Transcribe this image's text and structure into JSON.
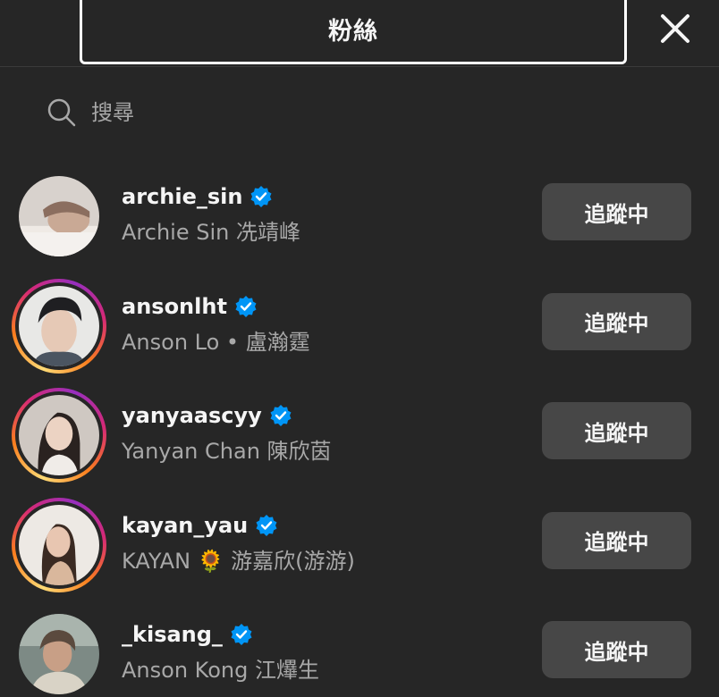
{
  "header": {
    "title": "粉絲",
    "close_icon": "close-icon"
  },
  "search": {
    "placeholder": "搜尋",
    "icon": "search-icon"
  },
  "colors": {
    "background": "#262626",
    "button_bg": "#474747",
    "verified": "#0095f6",
    "secondary_text": "#a8a8a8"
  },
  "users": [
    {
      "username": "archie_sin",
      "full_name": "Archie Sin 冼靖峰",
      "verified": true,
      "story_ring": false,
      "button_label": "追蹤中"
    },
    {
      "username": "ansonlht",
      "full_name": "Anson Lo • 盧瀚霆",
      "verified": true,
      "story_ring": true,
      "button_label": "追蹤中"
    },
    {
      "username": "yanyaascyy",
      "full_name": "Yanyan Chan 陳欣茵",
      "verified": true,
      "story_ring": true,
      "button_label": "追蹤中"
    },
    {
      "username": "kayan_yau",
      "full_name": "KAYAN 🌻 游嘉欣(游游)",
      "verified": true,
      "story_ring": true,
      "button_label": "追蹤中"
    },
    {
      "username": "_kisang_",
      "full_name": "Anson Kong 江𤒹生",
      "verified": true,
      "story_ring": false,
      "button_label": "追蹤中"
    }
  ]
}
